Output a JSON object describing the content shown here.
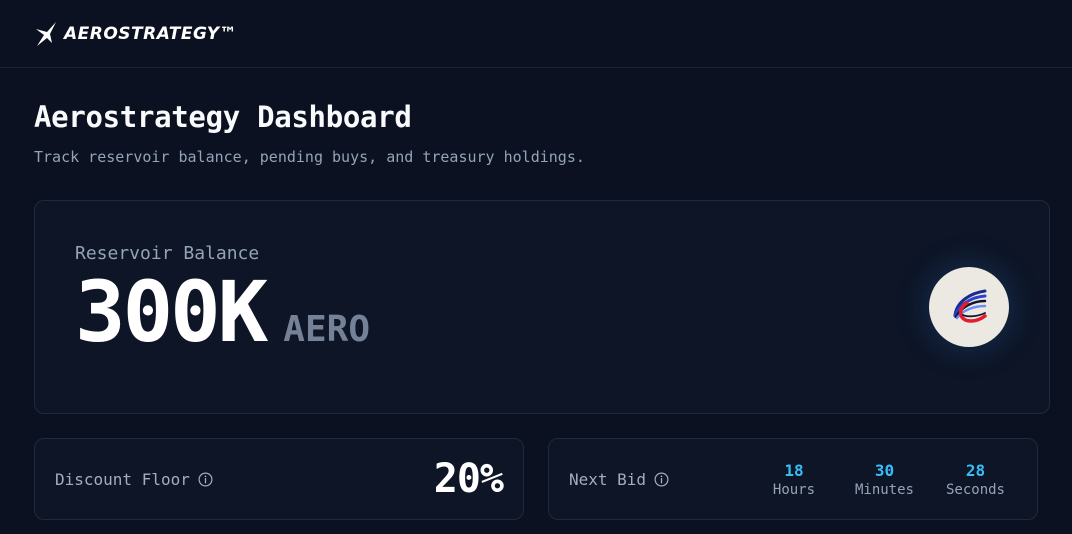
{
  "brand": {
    "name": "AEROSTRATEGY™"
  },
  "page": {
    "title": "Aerostrategy Dashboard",
    "subtitle": "Track reservoir balance, pending buys, and treasury holdings."
  },
  "reservoir": {
    "label": "Reservoir Balance",
    "value": "300K",
    "unit": "AERO",
    "token_icon": "aero-token-icon"
  },
  "discount_floor": {
    "label": "Discount Floor",
    "value": "20%"
  },
  "next_bid": {
    "label": "Next Bid",
    "countdown": [
      {
        "value": "18",
        "label": "Hours"
      },
      {
        "value": "30",
        "label": "Minutes"
      },
      {
        "value": "28",
        "label": "Seconds"
      }
    ]
  },
  "colors": {
    "background": "#0b1120",
    "card": "#0d1526",
    "accent": "#38bdf8",
    "muted": "#94a3b8"
  }
}
